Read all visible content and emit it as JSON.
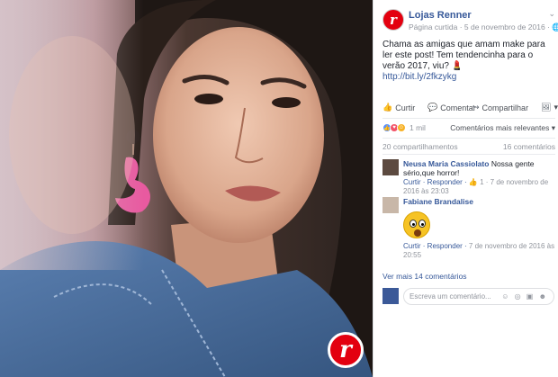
{
  "photo": {
    "brand_badge": "r"
  },
  "post": {
    "page_avatar": "r",
    "page_name": "Lojas Renner",
    "page_meta": "Página curtida · 5 de novembro de 2016 · ",
    "chevron": "⌄",
    "text": "Chama as amigas que amam make para ler este post! Tem tendencinha para o verão 2017, viu? 💄",
    "link": "http://bit.ly/2fkzykg"
  },
  "actions": {
    "like": "Curtir",
    "comment": "Comentar",
    "share": "Compartilhar",
    "menu": "▾"
  },
  "reactions": {
    "count": "1 mil",
    "sort_label": "Comentários mais relevantes ▾"
  },
  "counts": {
    "shares": "20 compartilhamentos",
    "comments": "16 comentários"
  },
  "comments": [
    {
      "author": "Neusa Maria Cassiolato",
      "text": "Nossa gente sério,que horror!",
      "reply_like": "Curtir · Responder · ",
      "likes": "👍 1",
      "time": " · 7 de novembro de 2016 às 23:03"
    },
    {
      "author": "Fabiane Brandalise",
      "text": "",
      "reply_like": "Curtir · Responder · ",
      "time": "7 de novembro de 2016 às 20:55"
    }
  ],
  "more_comments": "Ver mais 14 comentários",
  "write_comment": {
    "placeholder": "Escreva um comentário...",
    "icons": "☺ ◎ ▣ ☻"
  },
  "colors": {
    "fb_link": "#365899",
    "brand_red": "#e3000f",
    "muted": "#90949c"
  }
}
